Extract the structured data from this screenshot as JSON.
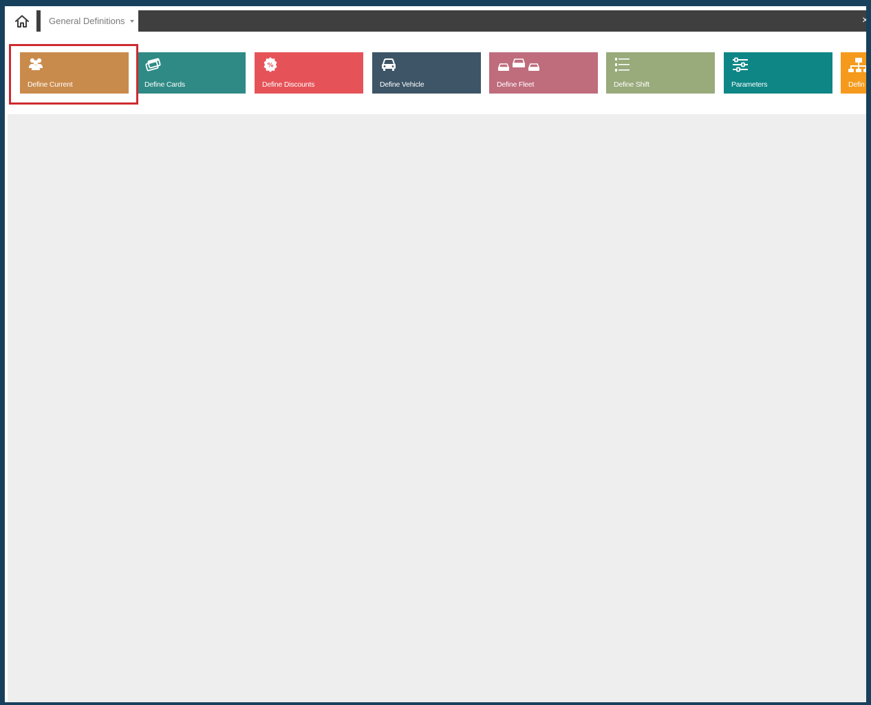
{
  "window": {
    "frame_color": "#17405c"
  },
  "topbar": {
    "home_icon": "home-icon",
    "tab_label": "General Definitions",
    "close_glyph": "×"
  },
  "tiles": [
    {
      "label": "Define Current",
      "icon": "users-icon",
      "color": "#c98b4c"
    },
    {
      "label": "Define Cards",
      "icon": "cards-icon",
      "color": "#2f8a85"
    },
    {
      "label": "Define Discounts",
      "icon": "discount-icon",
      "color": "#e55358"
    },
    {
      "label": "Define Vehicle",
      "icon": "car-icon",
      "color": "#3d5567"
    },
    {
      "label": "Define Fleet",
      "icon": "fleet-icon",
      "color": "#bf6c7d"
    },
    {
      "label": "Define Shift",
      "icon": "list-icon",
      "color": "#99aa7b"
    },
    {
      "label": "Parameters",
      "icon": "sliders-icon",
      "color": "#0e8686"
    },
    {
      "label": "Defin",
      "icon": "sitemap-icon",
      "color": "#f59a1c"
    }
  ],
  "selected_tile": "Define Current"
}
